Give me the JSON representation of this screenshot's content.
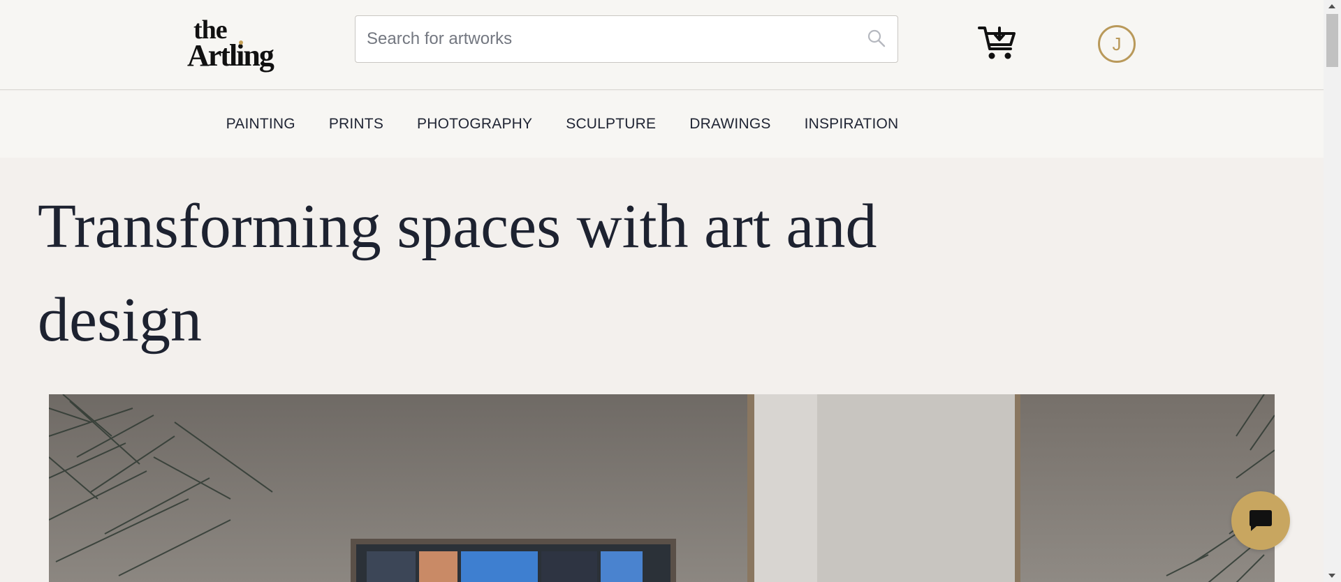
{
  "header": {
    "logo": {
      "line1": "the",
      "line2": "Artling"
    },
    "search": {
      "placeholder": "Search for artworks",
      "value": "",
      "icon": "search-icon"
    },
    "cart": {
      "icon": "cart-download-icon"
    },
    "avatar": {
      "initial": "J"
    }
  },
  "nav": {
    "items": [
      {
        "label": "PAINTING"
      },
      {
        "label": "PRINTS"
      },
      {
        "label": "PHOTOGRAPHY"
      },
      {
        "label": "SCULPTURE"
      },
      {
        "label": "DRAWINGS"
      },
      {
        "label": "INSPIRATION"
      }
    ]
  },
  "main": {
    "title": "Transforming spaces with art and design"
  },
  "chat": {
    "icon": "chat-bubble-icon"
  },
  "colors": {
    "accent": "#c8a660",
    "background": "#f3f0ed",
    "header_bg": "#f7f6f3",
    "text": "#1d2230"
  }
}
